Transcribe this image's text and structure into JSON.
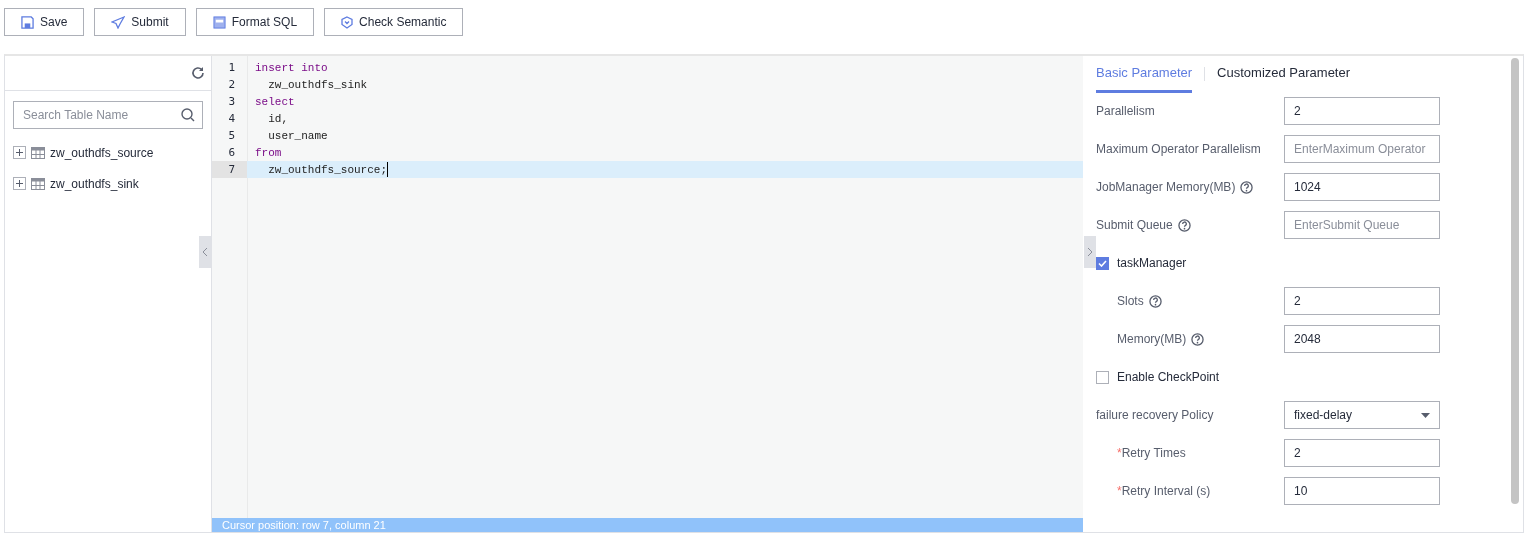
{
  "toolbar": [
    {
      "label": "Save"
    },
    {
      "label": "Submit"
    },
    {
      "label": "Format SQL"
    },
    {
      "label": "Check Semantic"
    }
  ],
  "table_panel": {
    "search": {
      "placeholder": "Search Table Name"
    },
    "tables": [
      {
        "name": "zw_outhdfs_source",
        "expanded": false
      },
      {
        "name": "zw_outhdfs_sink",
        "expanded": false
      }
    ]
  },
  "editor": {
    "lines": [
      {
        "number": "1",
        "text": "insert into",
        "kind": "keyword",
        "selected": false
      },
      {
        "number": "2",
        "text": "  zw_outhdfs_sink",
        "kind": "plain",
        "selected": false
      },
      {
        "number": "3",
        "text": "select",
        "kind": "keyword",
        "selected": false
      },
      {
        "number": "4",
        "text": "  id,",
        "kind": "plain",
        "selected": false
      },
      {
        "number": "5",
        "text": "  user_name",
        "kind": "plain",
        "selected": false
      },
      {
        "number": "6",
        "text": "from",
        "kind": "keyword",
        "selected": false
      },
      {
        "number": "7",
        "text": "  zw_outhdfs_source;",
        "kind": "plain",
        "selected": true
      }
    ],
    "status_bar": "Cursor position: row 7, column 21"
  },
  "parameters": {
    "tabs": [
      {
        "label": "Basic Parameter",
        "selected": true
      },
      {
        "label": "Customized Parameter",
        "selected": false
      }
    ],
    "rows": [
      {
        "kind": "input",
        "label": "Parallelism",
        "help": false,
        "nested": false,
        "value": "2"
      },
      {
        "kind": "input",
        "label": "Maximum Operator Parallelism",
        "help": false,
        "nested": false,
        "placeholder": "EnterMaximum Operator"
      },
      {
        "kind": "input",
        "label": "JobManager Memory(MB)",
        "help": true,
        "nested": false,
        "value": "1024"
      },
      {
        "kind": "input",
        "label": "Submit Queue",
        "help": true,
        "nested": false,
        "placeholder": "EnterSubmit Queue"
      },
      {
        "kind": "checkbox",
        "label": "taskManager",
        "checked": true
      },
      {
        "kind": "input",
        "label": "Slots",
        "help": true,
        "nested": true,
        "value": "2"
      },
      {
        "kind": "input",
        "label": "Memory(MB)",
        "help": true,
        "nested": true,
        "value": "2048"
      },
      {
        "kind": "checkbox",
        "label": "Enable CheckPoint",
        "checked": false
      },
      {
        "kind": "select",
        "label": "failure recovery Policy",
        "help": false,
        "nested": false,
        "value": "fixed-delay"
      },
      {
        "kind": "input",
        "label": "Retry Times",
        "help": false,
        "required_mark": "*",
        "nested": true,
        "value": "2"
      },
      {
        "kind": "input",
        "label": "Retry Interval (s)",
        "help": false,
        "required_mark": "*",
        "nested": true,
        "value": "10"
      }
    ]
  }
}
